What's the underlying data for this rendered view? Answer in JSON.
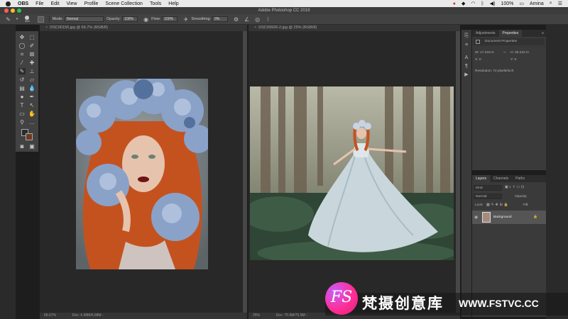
{
  "menubar": {
    "items": [
      "OBS",
      "File",
      "Edit",
      "View",
      "Profile",
      "Scene Collection",
      "Tools",
      "Help"
    ],
    "battery": "100%",
    "user": "Amina"
  },
  "window": {
    "title": "Adobe Photoshop CC 2019"
  },
  "options": {
    "brush_size": "300",
    "mode_label": "Mode:",
    "mode_value": "Normal",
    "opacity_label": "Opacity:",
    "opacity_value": "100%",
    "flow_label": "Flow:",
    "flow_value": "100%",
    "smoothing_label": "Smoothing:",
    "smoothing_value": "0%"
  },
  "documents": [
    {
      "tab": "DSC00156.jpg @ 66.7% (RGB/8)",
      "zoom": "66.67%",
      "doc_size": "Doc: 6.68M/6.68M"
    },
    {
      "tab": "DSC09926-2.jpg @ 25% (RGB/8)",
      "zoom": "25%",
      "doc_size": "Doc: 75.9M/75.9M"
    }
  ],
  "properties_panel": {
    "tabs": [
      "Adjustments",
      "Properties"
    ],
    "heading": "Document Properties",
    "w": "W: 17.316 in",
    "h": "H: 28.222 in",
    "x": "X: 0",
    "y": "Y: 0",
    "resolution": "Resolution: 72 pixels/inch"
  },
  "layers_panel": {
    "tabs": [
      "Layers",
      "Channels",
      "Paths"
    ],
    "kind": "Kind",
    "blend": "Normal",
    "opacity": "Opacity:",
    "lock": "Lock:",
    "fill": "Fill:",
    "layer_name": "Background"
  },
  "watermark": {
    "logo": "FS",
    "brand_cn": "梵摄创意库",
    "url": "WWW.FSTVC.CC"
  },
  "colors": {
    "ui_dark": "#282828",
    "panel": "#3a3a3a",
    "hair": "#c4521f",
    "flowers": "#8aa2c8",
    "brand_pink": "#ff2e95"
  }
}
